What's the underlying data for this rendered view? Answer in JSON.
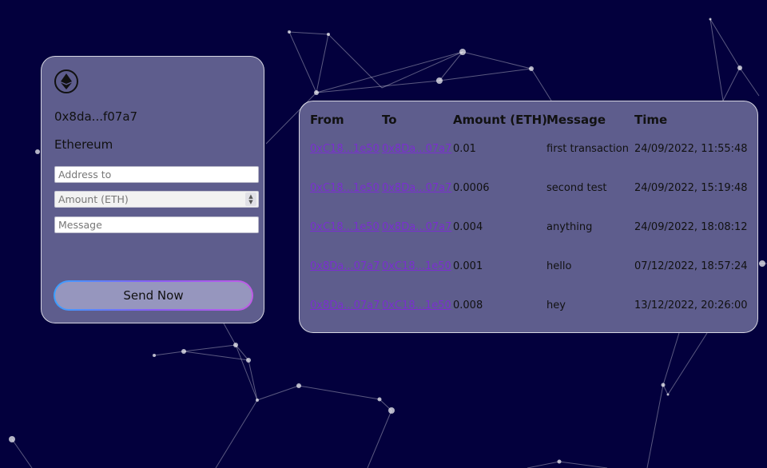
{
  "wallet": {
    "address": "0x8da...f07a7",
    "network": "Ethereum",
    "address_placeholder": "Address to",
    "amount_placeholder": "Amount (ETH)",
    "message_placeholder": "Message",
    "send_label": "Send Now"
  },
  "transactions": {
    "headers": [
      "From",
      "To",
      "Amount (ETH)",
      "Message",
      "Time"
    ],
    "rows": [
      {
        "from": "0xC18...1e50",
        "to": "0x8Da...07a7",
        "amount": "0.01",
        "message": "first transaction",
        "time": "24/09/2022, 11:55:48"
      },
      {
        "from": "0xC18...1e50",
        "to": "0x8Da...07a7",
        "amount": "0.0006",
        "message": "second test",
        "time": "24/09/2022, 15:19:48"
      },
      {
        "from": "0xC18...1e50",
        "to": "0x8Da...07a7",
        "amount": "0.004",
        "message": "anything",
        "time": "24/09/2022, 18:08:12"
      },
      {
        "from": "0x8Da...07a7",
        "to": "0xC18...1e50",
        "amount": "0.001",
        "message": "hello",
        "time": "07/12/2022, 18:57:24"
      },
      {
        "from": "0x8Da...07a7",
        "to": "0xC18...1e50",
        "amount": "0.008",
        "message": "hey",
        "time": "13/12/2022, 20:26:00"
      }
    ]
  },
  "colors": {
    "background": "#03003d",
    "link": "#7a2fd0",
    "button_gradient": [
      "#3aa0ff",
      "#8a5cf6",
      "#c05ce6"
    ]
  }
}
